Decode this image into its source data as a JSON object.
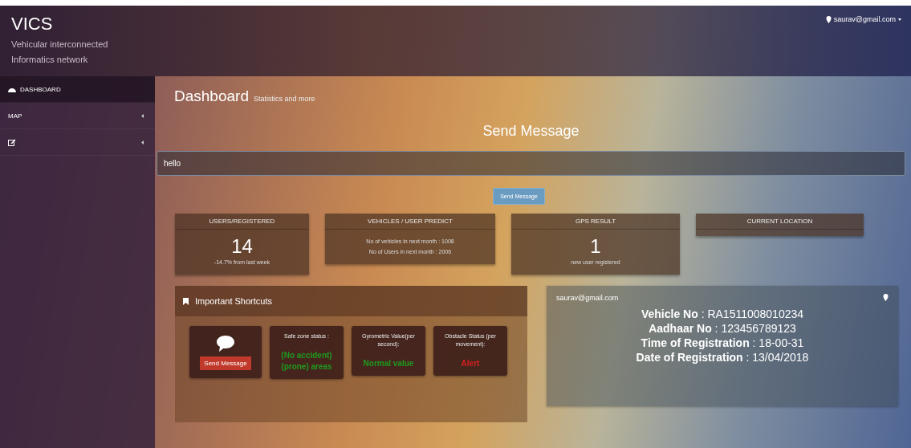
{
  "brand": {
    "title": "VICS",
    "subtitle": "Vehicular interconnected Informatics network"
  },
  "user_menu": {
    "label": "saurav@gmail.com"
  },
  "sidebar": {
    "items": [
      {
        "kind": "gauge",
        "label": "DASHBOARD",
        "selected": true,
        "expandable": false
      },
      {
        "kind": "text",
        "label": "MAP",
        "selected": false,
        "expandable": true
      },
      {
        "kind": "edit",
        "selected": false,
        "expandable": true
      }
    ]
  },
  "page": {
    "title": "Dashboard",
    "subtitle": "Statistics and more"
  },
  "message": {
    "heading": "Send Message",
    "value": "hello",
    "button": "Send Message"
  },
  "stats": [
    {
      "title": "USERS/REGISTERED",
      "kind": "number",
      "value": "14",
      "note": "-14.7% from last week"
    },
    {
      "title": "VEHICLES / USER PREDICT",
      "kind": "lines",
      "lines": [
        "No of vehicles in next month : 1008",
        "No of Users in next month : 2006"
      ]
    },
    {
      "title": "GPS RESULT",
      "kind": "number",
      "value": "1",
      "note": "new user registered"
    },
    {
      "title": "CURRENT LOCATION",
      "kind": "empty"
    }
  ],
  "shortcuts": {
    "title": "Important Shortcuts",
    "tiles": [
      {
        "kind": "action",
        "button": "Send Message"
      },
      {
        "kind": "status",
        "label": "Safe zone status :",
        "value": "(No accident) (prone) areas",
        "color": "#1f9a1f"
      },
      {
        "kind": "status",
        "label": "Gyrometric Value(per second):",
        "value": "Normal value",
        "color": "#1f9a1f"
      },
      {
        "kind": "status",
        "label": "Obstacle Status (per movement):",
        "value": "Alert",
        "color": "#d42020"
      }
    ]
  },
  "profile": {
    "email": "saurav@gmail.com",
    "fields": [
      "**Vehicle No** : RA1511008010234",
      "**Aadhaar No** : 123456789123",
      "**Time of Registration** : 18-00-31",
      "**Date of Registration** : 13/04/2018"
    ]
  }
}
